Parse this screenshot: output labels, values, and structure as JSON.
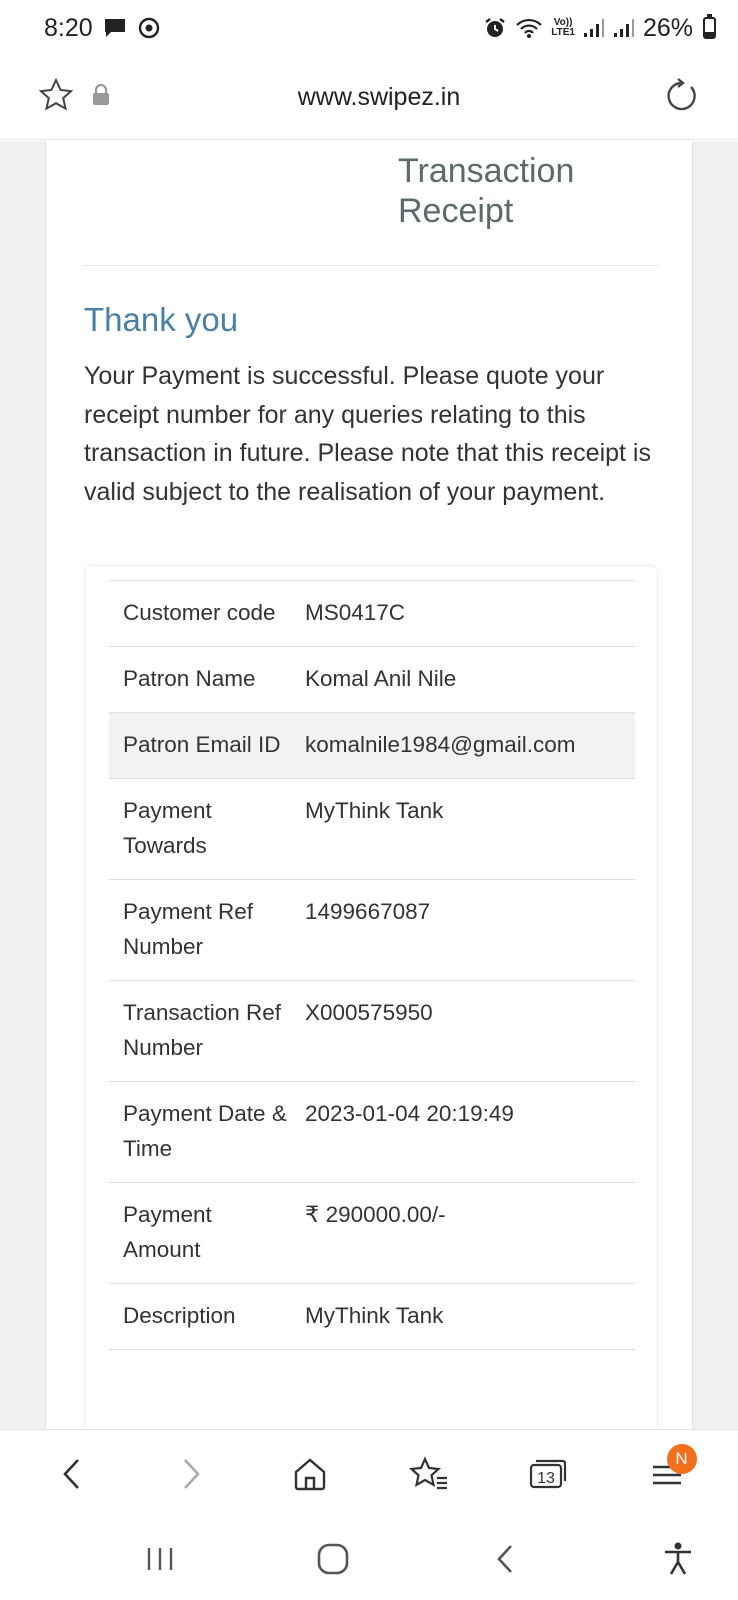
{
  "status_bar": {
    "time": "8:20",
    "battery_percent": "26%",
    "network_label_top": "Vo))",
    "network_label_bottom": "LTE1",
    "battery_level": 0.26
  },
  "browser": {
    "url": "www.swipez.in",
    "tab_count": "13",
    "notification_badge": "N"
  },
  "receipt": {
    "title": "Transaction Receipt",
    "heading": "Thank you",
    "message": "Your Payment is successful. Please quote your receipt number for any queries relating to this transaction in future. Please note that this receipt is valid subject to the realisation of your payment.",
    "rows": [
      {
        "label": "Customer code",
        "value": "MS0417C"
      },
      {
        "label": "Patron Name",
        "value": "Komal Anil Nile"
      },
      {
        "label": "Patron Email ID",
        "value": "komalnile1984@gmail.com"
      },
      {
        "label": "Payment Towards",
        "value": "MyThink Tank"
      },
      {
        "label": "Payment Ref Number",
        "value": "1499667087"
      },
      {
        "label": "Transaction Ref Number",
        "value": "X000575950"
      },
      {
        "label": "Payment Date & Time",
        "value": "2023-01-04 20:19:49"
      },
      {
        "label": "Payment Amount",
        "value": "₹ 290000.00/-"
      },
      {
        "label": "Description",
        "value": "MyThink Tank"
      }
    ]
  },
  "colors": {
    "heading_blue": "#4a7fa8",
    "title_gray": "#5b6b6b",
    "badge_orange": "#f26f1c"
  }
}
